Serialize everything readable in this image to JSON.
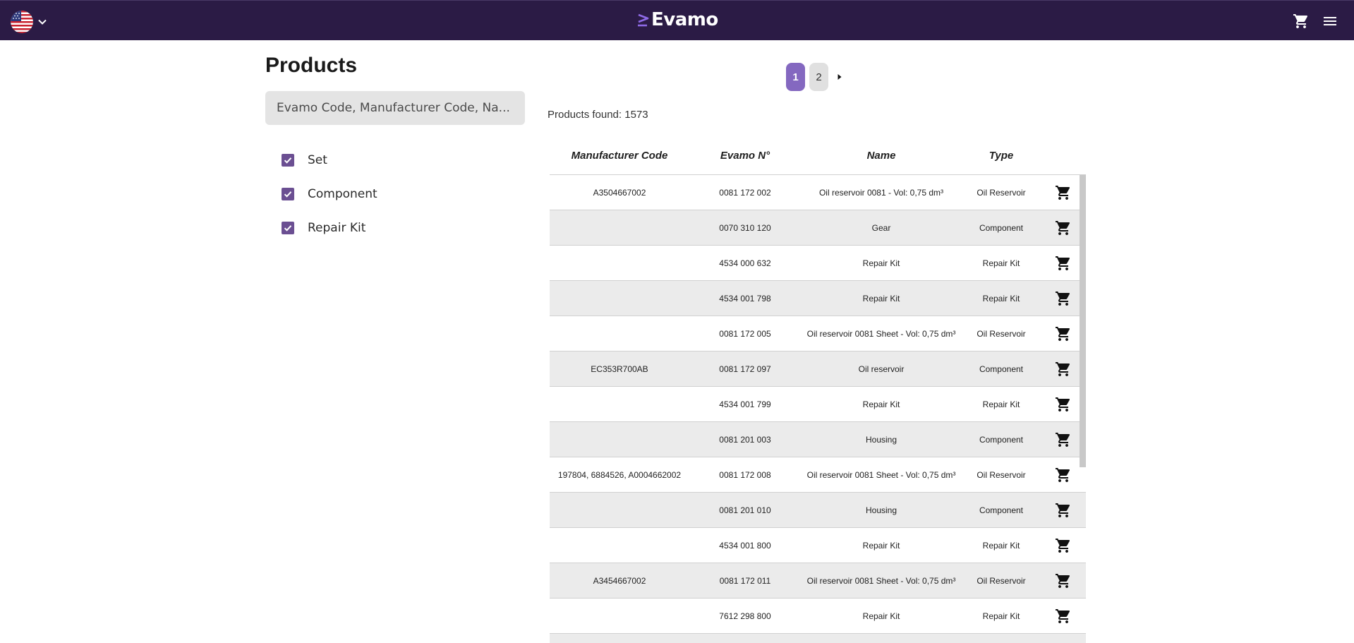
{
  "header": {
    "brand": "Evamo",
    "language_icon": "us-flag-icon",
    "cart_icon": "cart-icon",
    "menu_icon": "hamburger-menu-icon"
  },
  "page": {
    "title": "Products",
    "search_placeholder": "Evamo Code, Manufacturer Code, Na...",
    "filters": [
      {
        "label": "Set",
        "checked": true
      },
      {
        "label": "Component",
        "checked": true
      },
      {
        "label": "Repair Kit",
        "checked": true
      }
    ],
    "pagination": {
      "pages": [
        "1",
        "2"
      ],
      "current": "1"
    },
    "products_found_label": "Products found: 1573"
  },
  "colors": {
    "header_bg": "#2b1b45",
    "accent": "#8468c0",
    "checkbox": "#6b4f92",
    "row_alt": "#ebebeb"
  },
  "table": {
    "columns": [
      "Manufacturer Code",
      "Evamo N°",
      "Name",
      "Type"
    ],
    "rows": [
      {
        "manufacturer_code": "A3504667002",
        "evamo_no": "0081 172 002",
        "name": "Oil reservoir 0081 - Vol: 0,75 dm³",
        "type": "Oil Reservoir"
      },
      {
        "manufacturer_code": "",
        "evamo_no": "0070 310 120",
        "name": "Gear",
        "type": "Component"
      },
      {
        "manufacturer_code": "",
        "evamo_no": "4534 000 632",
        "name": "Repair Kit",
        "type": "Repair Kit"
      },
      {
        "manufacturer_code": "",
        "evamo_no": "4534 001 798",
        "name": "Repair Kit",
        "type": "Repair Kit"
      },
      {
        "manufacturer_code": "",
        "evamo_no": "0081 172 005",
        "name": "Oil reservoir 0081 Sheet - Vol: 0,75 dm³",
        "type": "Oil Reservoir"
      },
      {
        "manufacturer_code": "EC353R700AB",
        "evamo_no": "0081 172 097",
        "name": "Oil reservoir",
        "type": "Component"
      },
      {
        "manufacturer_code": "",
        "evamo_no": "4534 001 799",
        "name": "Repair Kit",
        "type": "Repair Kit"
      },
      {
        "manufacturer_code": "",
        "evamo_no": "0081 201 003",
        "name": "Housing",
        "type": "Component"
      },
      {
        "manufacturer_code": "197804, 6884526, A0004662002",
        "evamo_no": "0081 172 008",
        "name": "Oil reservoir 0081 Sheet - Vol: 0,75 dm³",
        "type": "Oil Reservoir"
      },
      {
        "manufacturer_code": "",
        "evamo_no": "0081 201 010",
        "name": "Housing",
        "type": "Component"
      },
      {
        "manufacturer_code": "",
        "evamo_no": "4534 001 800",
        "name": "Repair Kit",
        "type": "Repair Kit"
      },
      {
        "manufacturer_code": "A3454667002",
        "evamo_no": "0081 172 011",
        "name": "Oil reservoir 0081 Sheet - Vol: 0,75 dm³",
        "type": "Oil Reservoir"
      },
      {
        "manufacturer_code": "",
        "evamo_no": "7612 298 800",
        "name": "Repair Kit",
        "type": "Repair Kit"
      },
      {
        "manufacturer_code": "",
        "evamo_no": "",
        "name": "",
        "type": ""
      }
    ]
  }
}
